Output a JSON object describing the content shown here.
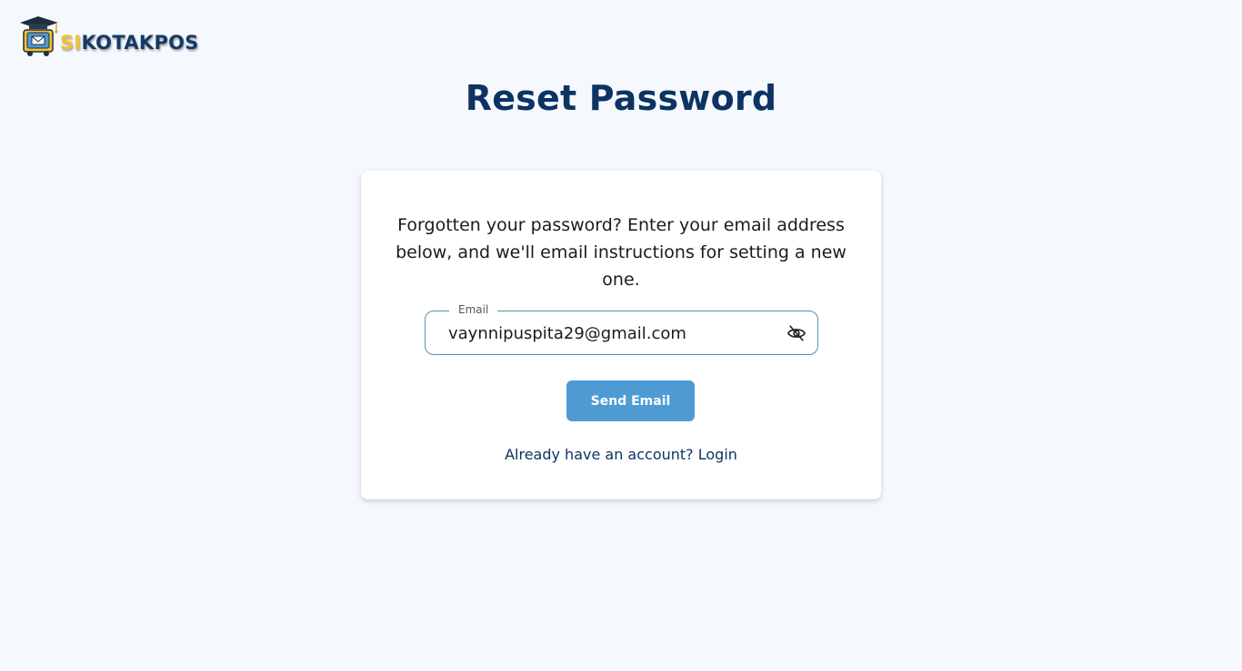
{
  "brand": {
    "prefix": "SI",
    "name": "KOTAKPOS",
    "colors": {
      "prefix": "#f2c230",
      "name": "#163a66"
    },
    "icon": "graduation-mailbox-logo"
  },
  "page": {
    "title": "Reset Password"
  },
  "form": {
    "description": "Forgotten your password? Enter your email address below, and we'll email instructions for setting a new one.",
    "email": {
      "label": "Email",
      "value": "vaynnipuspita29@gmail.com",
      "toggle_icon": "eye-off-icon"
    },
    "submit_label": "Send Email",
    "login_link": "Already have an account? Login"
  },
  "colors": {
    "background": "#f5f9fe",
    "title": "#0d3362",
    "button": "#4e9bd3",
    "field_border": "#5b8fa8"
  }
}
